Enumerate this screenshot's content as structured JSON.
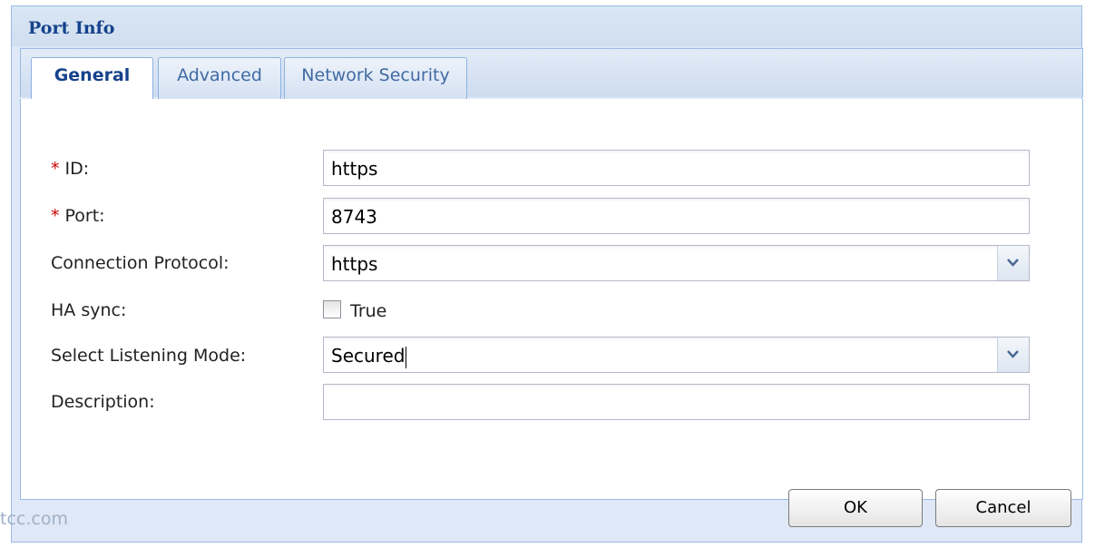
{
  "dialog": {
    "title": "Port Info",
    "tabs": [
      {
        "label": "General",
        "active": true
      },
      {
        "label": "Advanced",
        "active": false
      },
      {
        "label": "Network Security",
        "active": false
      }
    ],
    "required_marker": "*",
    "fields": {
      "id": {
        "label": "ID:",
        "value": "https"
      },
      "port": {
        "label": "Port:",
        "value": "8743"
      },
      "connection_protocol": {
        "label": "Connection Protocol:",
        "value": "https"
      },
      "ha_sync": {
        "label": "HA sync:",
        "option_label": "True",
        "checked": false
      },
      "listening_mode": {
        "label": "Select Listening Mode:",
        "value": "Secured"
      },
      "description": {
        "label": "Description:",
        "value": ""
      }
    },
    "buttons": {
      "ok": "OK",
      "cancel": "Cancel"
    }
  },
  "watermark": "tcc.com",
  "colors": {
    "title_text": "#15428b",
    "required_marker": "#cc0000",
    "dialog_background": "#dfe8f6",
    "border": "#99bbe8"
  }
}
